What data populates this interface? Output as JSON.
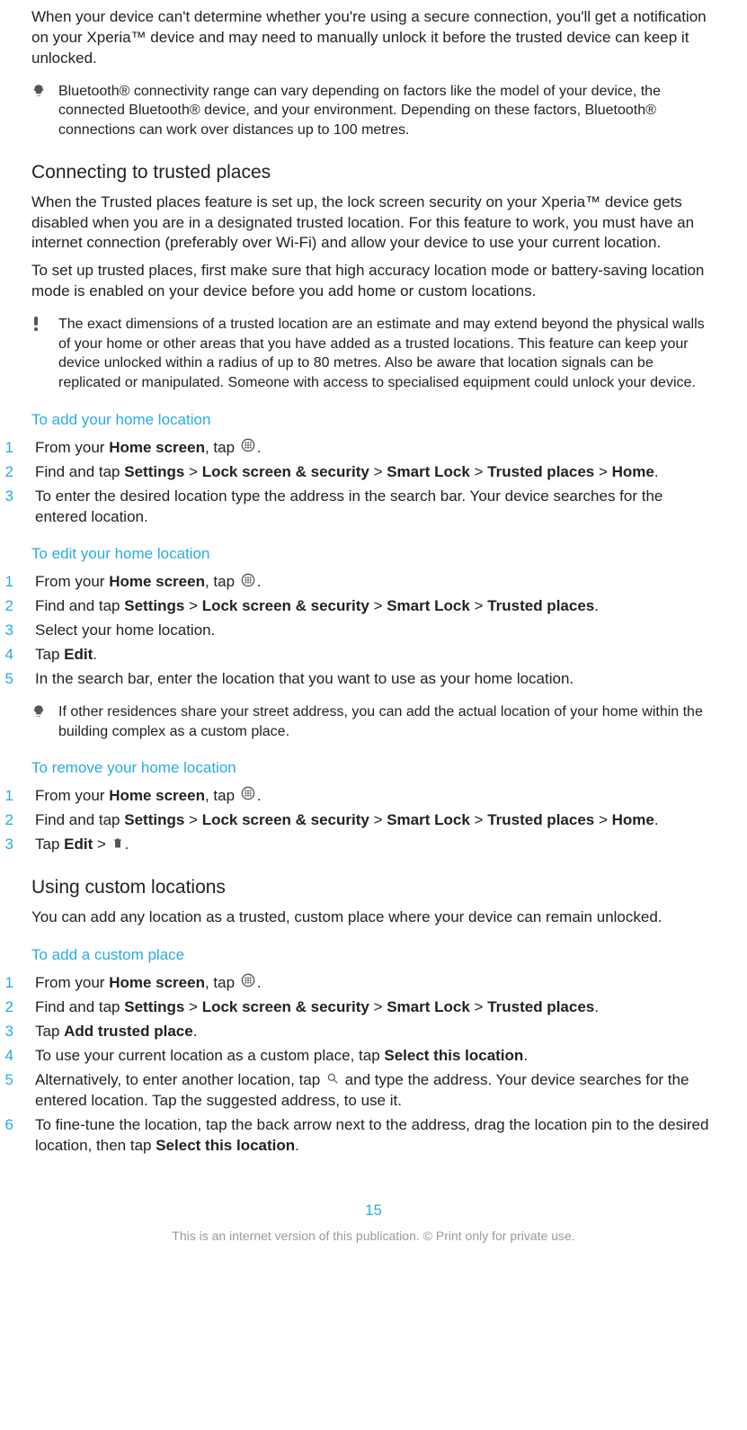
{
  "intro_secure_connection": "When your device can't determine whether you're using a secure connection, you'll get a notification on your Xperia™ device and may need to manually unlock it before the trusted device can keep it unlocked.",
  "tip_bluetooth": "Bluetooth® connectivity range can vary depending on factors like the model of your device, the connected Bluetooth® device, and your environment. Depending on these factors, Bluetooth® connections can work over distances up to 100 metres.",
  "h_trusted_places": "Connecting to trusted places",
  "trusted_places_p1": "When the Trusted places feature is set up, the lock screen security on your Xperia™ device gets disabled when you are in a designated trusted location. For this feature to work, you must have an internet connection (preferably over Wi-Fi) and allow your device to use your current location.",
  "trusted_places_p2": "To set up trusted places, first make sure that high accuracy location mode or battery-saving location mode is enabled on your device before you add home or custom locations.",
  "warn_dimensions": "The exact dimensions of a trusted location are an estimate and may extend beyond the physical walls of your home or other areas that you have added as a trusted locations. This feature can keep your device unlocked within a radius of up to 80 metres. Also be aware that location signals can be replicated or manipulated. Someone with access to specialised equipment could unlock your device.",
  "h_add_home": "To add your home location",
  "add_home": {
    "s1_a": "From your ",
    "s1_b": "Home screen",
    "s1_c": ", tap ",
    "s1_d": ".",
    "s2_a": "Find and tap ",
    "s2_b": "Settings",
    "s2_c": " > ",
    "s2_d": "Lock screen & security",
    "s2_e": " > ",
    "s2_f": "Smart Lock",
    "s2_g": " > ",
    "s2_h": "Trusted places",
    "s2_i": " > ",
    "s2_j": "Home",
    "s2_k": ".",
    "s3": "To enter the desired location type the address in the search bar. Your device searches for the entered location."
  },
  "h_edit_home": "To edit your home location",
  "edit_home": {
    "s1_a": "From your ",
    "s1_b": "Home screen",
    "s1_c": ", tap ",
    "s1_d": ".",
    "s2_a": "Find and tap ",
    "s2_b": "Settings",
    "s2_c": " > ",
    "s2_d": "Lock screen & security",
    "s2_e": " > ",
    "s2_f": "Smart Lock",
    "s2_g": " > ",
    "s2_h": "Trusted places",
    "s2_i": ".",
    "s3": "Select your home location.",
    "s4_a": "Tap ",
    "s4_b": "Edit",
    "s4_c": ".",
    "s5": "In the search bar, enter the location that you want to use as your home location."
  },
  "tip_residences": "If other residences share your street address, you can add the actual location of your home within the building complex as a custom place.",
  "h_remove_home": "To remove your home location",
  "remove_home": {
    "s1_a": "From your ",
    "s1_b": "Home screen",
    "s1_c": ", tap ",
    "s1_d": ".",
    "s2_a": "Find and tap ",
    "s2_b": "Settings",
    "s2_c": " > ",
    "s2_d": "Lock screen & security",
    "s2_e": " > ",
    "s2_f": "Smart Lock",
    "s2_g": " > ",
    "s2_h": "Trusted places",
    "s2_i": " > ",
    "s2_j": "Home",
    "s2_k": ".",
    "s3_a": "Tap ",
    "s3_b": "Edit",
    "s3_c": " > ",
    "s3_d": "."
  },
  "h_custom": "Using custom locations",
  "custom_p": "You can add any location as a trusted, custom place where your device can remain unlocked.",
  "h_add_custom": "To add a custom place",
  "add_custom": {
    "s1_a": "From your ",
    "s1_b": "Home screen",
    "s1_c": ", tap ",
    "s1_d": ".",
    "s2_a": "Find and tap ",
    "s2_b": "Settings",
    "s2_c": " > ",
    "s2_d": "Lock screen & security",
    "s2_e": " > ",
    "s2_f": "Smart Lock",
    "s2_g": " > ",
    "s2_h": "Trusted places",
    "s2_i": ".",
    "s3_a": "Tap ",
    "s3_b": "Add trusted place",
    "s3_c": ".",
    "s4_a": "To use your current location as a custom place, tap ",
    "s4_b": "Select this location",
    "s4_c": ".",
    "s5_a": "Alternatively, to enter another location, tap ",
    "s5_b": " and type the address. Your device searches for the entered location. Tap the suggested address, to use it.",
    "s6_a": "To fine-tune the location, tap the back arrow next to the address, drag the location pin to the desired location, then tap ",
    "s6_b": "Select this location",
    "s6_c": "."
  },
  "page_number": "15",
  "footer": "This is an internet version of this publication. © Print only for private use."
}
